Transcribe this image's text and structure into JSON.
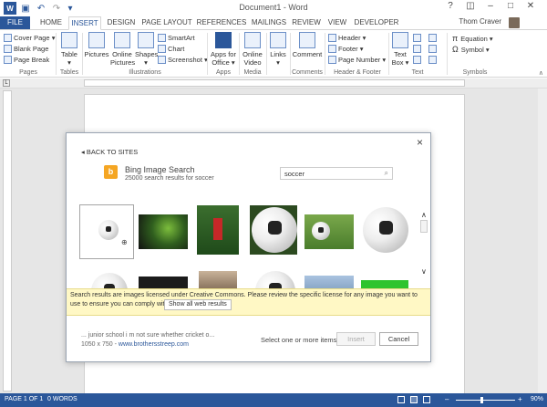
{
  "app": {
    "title": "Document1 - Word"
  },
  "qat": {
    "icon_word": "word-icon",
    "icon_save": "save-icon",
    "icon_undo": "undo-icon",
    "icon_redo": "redo-icon",
    "icon_more": "customize-icon"
  },
  "window": {
    "help": "?",
    "restore": "◫",
    "minimize": "–",
    "maximize": "□",
    "close": "✕"
  },
  "tabs": [
    "FILE",
    "HOME",
    "INSERT",
    "DESIGN",
    "PAGE LAYOUT",
    "REFERENCES",
    "MAILINGS",
    "REVIEW",
    "VIEW",
    "DEVELOPER"
  ],
  "active_tab": "INSERT",
  "user": {
    "name": "Thom Craver"
  },
  "ribbon": {
    "pages": {
      "cover": "Cover Page ▾",
      "blank": "Blank Page",
      "break": "Page Break",
      "label": "Pages"
    },
    "tables": {
      "table": "Table",
      "label": "Tables"
    },
    "illustrations": {
      "pictures": "Pictures",
      "online": "Online",
      "online2": "Pictures",
      "shapes": "Shapes",
      "smartart": "SmartArt",
      "chart": "Chart",
      "screenshot": "Screenshot ▾",
      "label": "Illustrations"
    },
    "apps": {
      "apps1": "Apps for",
      "apps2": "Office ▾",
      "label": "Apps"
    },
    "media": {
      "v1": "Online",
      "v2": "Video",
      "label": "Media"
    },
    "links": {
      "links": "Links",
      "label": ""
    },
    "comments": {
      "comment": "Comment",
      "label": "Comments"
    },
    "header_footer": {
      "header": "Header ▾",
      "footer": "Footer ▾",
      "page_number": "Page Number ▾",
      "label": "Header & Footer"
    },
    "text": {
      "t1": "Text",
      "t2": "Box ▾",
      "label": "Text"
    },
    "symbols": {
      "equation": "Equation ▾",
      "symbol": "Symbol ▾",
      "label": "Symbols"
    }
  },
  "dialog": {
    "back": "BACK TO SITES",
    "close": "×",
    "source_title": "Bing Image Search",
    "result_count": "25000 search results for soccer",
    "search_value": "soccer",
    "notice": "Search results are images licensed under Creative Commons. Please review the specific license for any image you want to use to ensure you can comply with it.",
    "show_all": "Show all web results",
    "info_line1": "... junior school i m not sure whether cricket o...",
    "info_size": "1050 x 750",
    "info_sep": " - ",
    "info_link": "www.brothersstreep.com",
    "select_text": "Select one or more items.",
    "insert": "Insert",
    "cancel": "Cancel"
  },
  "status": {
    "page": "PAGE 1 OF 1",
    "words": "0 WORDS",
    "zoom": "90%"
  },
  "colors": {
    "accent": "#2b579a",
    "notice_bg": "#fff8c5",
    "bing": "#f5a623"
  }
}
